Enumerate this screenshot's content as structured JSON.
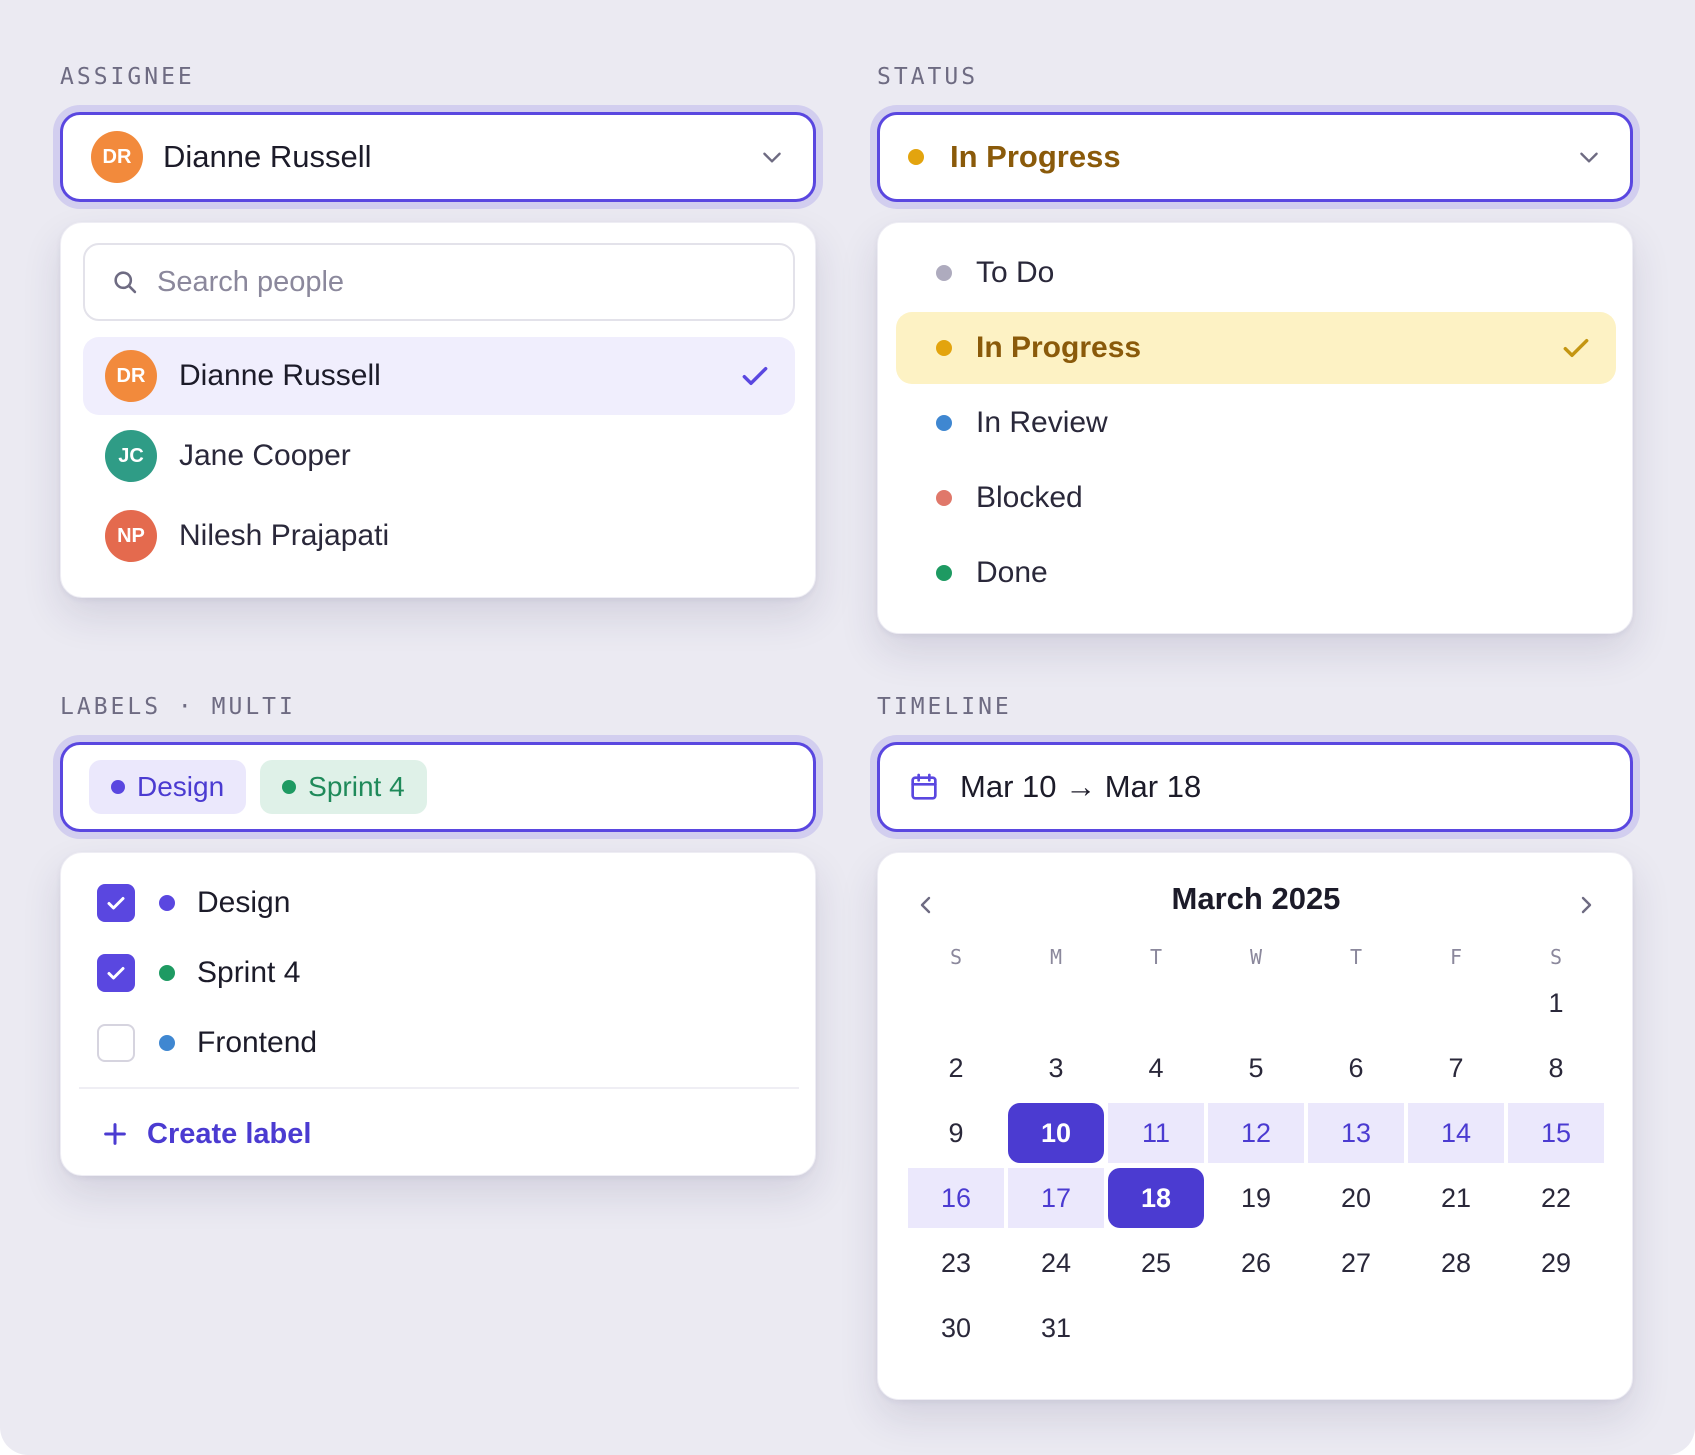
{
  "assignee": {
    "section_label": "ASSIGNEE",
    "selected": {
      "initials": "DR",
      "name": "Dianne Russell"
    },
    "search_placeholder": "Search people",
    "people": [
      {
        "initials": "DR",
        "name": "Dianne Russell",
        "selected": true
      },
      {
        "initials": "JC",
        "name": "Jane Cooper",
        "selected": false
      },
      {
        "initials": "NP",
        "name": "Nilesh Prajapati",
        "selected": false
      }
    ],
    "icons": {
      "search": "search-icon",
      "chevron": "chevron-down-icon",
      "check": "check-icon"
    }
  },
  "status": {
    "section_label": "STATUS",
    "selected": "In Progress",
    "options": [
      {
        "label": "To Do",
        "color": "#aeabbe"
      },
      {
        "label": "In Progress",
        "color": "#e3a40e",
        "selected": true
      },
      {
        "label": "In Review",
        "color": "#3f87d1"
      },
      {
        "label": "Blocked",
        "color": "#e0786a"
      },
      {
        "label": "Done",
        "color": "#1e9a62"
      }
    ]
  },
  "labels": {
    "section_label": "LABELS · MULTI",
    "chips": [
      {
        "label": "Design",
        "color": "#5a47e0"
      },
      {
        "label": "Sprint 4",
        "color": "#1e9a62"
      }
    ],
    "options": [
      {
        "label": "Design",
        "color": "#5a47e0",
        "checked": true
      },
      {
        "label": "Sprint 4",
        "color": "#1e9a62",
        "checked": true
      },
      {
        "label": "Frontend",
        "color": "#3f87d1",
        "checked": false
      }
    ],
    "create_label": "Create label"
  },
  "timeline": {
    "section_label": "TIMELINE",
    "range_text": "Mar 10 → Mar 18",
    "calendar": {
      "month_title": "March 2025",
      "weekdays": [
        "S",
        "M",
        "T",
        "W",
        "T",
        "F",
        "S"
      ],
      "first_weekday": 6,
      "days_in_month": 31,
      "range_start": 10,
      "range_end": 18
    }
  },
  "colors": {
    "accent": "#5a47e0",
    "accent_dark": "#4b3bd1",
    "background": "#ebeaf2"
  }
}
